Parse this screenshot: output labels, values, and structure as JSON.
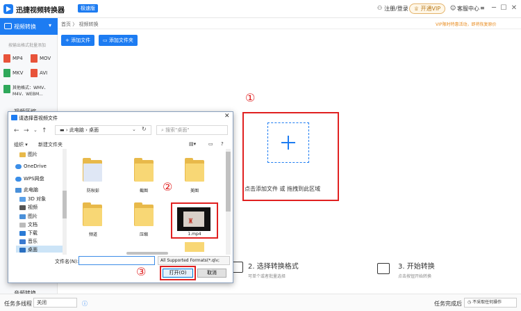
{
  "app": {
    "title": "迅捷视频转换器",
    "badge": "极速版",
    "login": "注册/登录",
    "vip": "开通VIP",
    "service": "客服中心"
  },
  "sidebar": {
    "active": "视频转换",
    "hint": "按输出格式批量添加",
    "formats": [
      "MP4",
      "MOV",
      "MKV",
      "AVI"
    ],
    "other_formats": [
      "其他格式：WMV、",
      "M4V、WEBM..."
    ],
    "sections": [
      "视频压缩",
      "音频转换"
    ]
  },
  "breadcrumb": {
    "home": "首页",
    "sep": "〉",
    "current": "视频转换"
  },
  "notice": "VIP限时特惠活动，即将恢复原价",
  "toolbar": {
    "add_file": "添加文件",
    "add_folder": "添加文件夹"
  },
  "dropzone": {
    "text": "点击添加文件 或 拖拽到此区域"
  },
  "markers": [
    "①",
    "②",
    "③"
  ],
  "steps": [
    {
      "title": "2. 选择转换格式",
      "sub": "可单个或者批量选择"
    },
    {
      "title": "3. 开始转换",
      "sub": "点击按钮开始转换"
    }
  ],
  "bottombar": {
    "multithread_label": "任务多线程",
    "multithread_value": "关闭",
    "done_label": "任务完成后",
    "done_value": "不采取任何操作"
  },
  "dialog": {
    "title": "请选择音视频文件",
    "path": [
      "此电脑",
      "桌面"
    ],
    "search_placeholder": "搜索\"桌面\"",
    "organize": "组织",
    "new_folder": "新建文件夹",
    "tree": [
      "图片",
      "OneDrive",
      "WPS网盘",
      "此电脑",
      "3D 对象",
      "视频",
      "图片",
      "文档",
      "下载",
      "音乐",
      "桌面"
    ],
    "folders": [
      "防秋彭",
      "截图",
      "美图",
      "频道",
      "压缩"
    ],
    "video_file": "1.mp4",
    "filename_label": "文件名(N):",
    "filetype": "All Supported Formats(*.qlv;",
    "open_button": "打开(O)",
    "cancel_button": "取消"
  },
  "colors": {
    "brand": "#1d7cf2",
    "marker": "#e02020",
    "folder": "#f8d775"
  }
}
